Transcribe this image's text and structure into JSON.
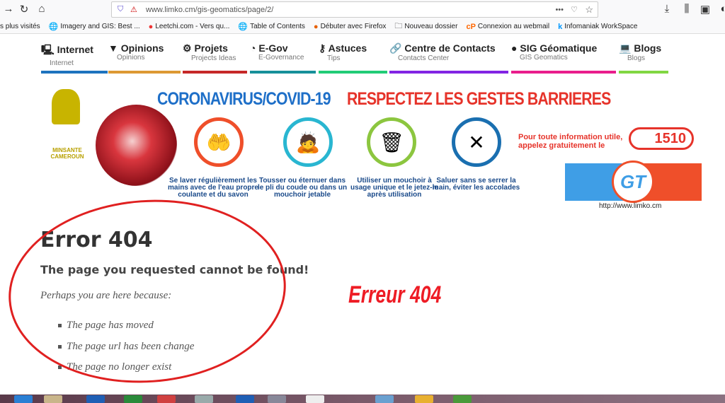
{
  "browser": {
    "url": "www.limko.cm/gis-geomatics/page/2/",
    "bookmarks": [
      {
        "label": "s plus visités",
        "icon": "none"
      },
      {
        "label": "Imagery and GIS: Best ...",
        "icon": "globe-icon"
      },
      {
        "label": "Leetchi.com - Vers qu...",
        "icon": "leetchi-icon"
      },
      {
        "label": "Table of Contents",
        "icon": "globe-icon"
      },
      {
        "label": "Débuter avec Firefox",
        "icon": "firefox-icon"
      },
      {
        "label": "Nouveau dossier",
        "icon": "folder-icon"
      },
      {
        "label": "Connexion au webmail",
        "icon": "cpanel-icon"
      },
      {
        "label": "Infomaniak WorkSpace",
        "icon": "infomaniak-icon"
      }
    ]
  },
  "nav": [
    {
      "label": "Internet",
      "sub": "Internet",
      "icon": "monitor-icon",
      "color": "#1e73be"
    },
    {
      "label": "Opinions",
      "sub": "Opinions",
      "icon": "comment-icon",
      "color": "#dd9933"
    },
    {
      "label": "Projets",
      "sub": "Projects Ideas",
      "icon": "gear-icon",
      "color": "#c62828"
    },
    {
      "label": "E-Gov",
      "sub": "E-Governance",
      "icon": "rss-icon",
      "color": "#17909a"
    },
    {
      "label": "Astuces",
      "sub": "Tips",
      "icon": "key-icon",
      "color": "#22cc77"
    },
    {
      "label": "Centre de Contacts",
      "sub": "Contacts Center",
      "icon": "link-icon",
      "color": "#8224e3"
    },
    {
      "label": "SIG Géomatique",
      "sub": "GIS Geomatics",
      "icon": "globe-icon",
      "color": "#e91e8c"
    },
    {
      "label": "Blogs",
      "sub": "Blogs",
      "icon": "laptop-icon",
      "color": "#81d742"
    }
  ],
  "banner": {
    "logo": [
      "MINSANTE",
      "CAMEROUN"
    ],
    "title": "CORONAVIRUS/COVID-19",
    "slogan": "RESPECTEZ LES GESTES BARRIERES",
    "captions": [
      "Se laver régulièrement les mains avec de l'eau propre coulante et du savon",
      "Tousser ou éternuer dans le pli du coude ou dans un mouchoir jetable",
      "Utiliser un mouchoir à usage unique et le jetez-le après utilisation",
      "Saluer sans se serrer la main, éviter les accolades"
    ],
    "info": "Pour toute information utile, appelez gratuitement le",
    "phone": "1510",
    "gt_logo": "GT",
    "site_url": "http://www.limko.cm"
  },
  "error": {
    "title": "Error 404",
    "subtitle": "The page you requested cannot be found!",
    "perhaps": "Perhaps you are here because:",
    "reasons": [
      "The page has moved",
      "The page url has been change",
      "The page no longer exist"
    ],
    "annotation": "Erreur 404"
  }
}
